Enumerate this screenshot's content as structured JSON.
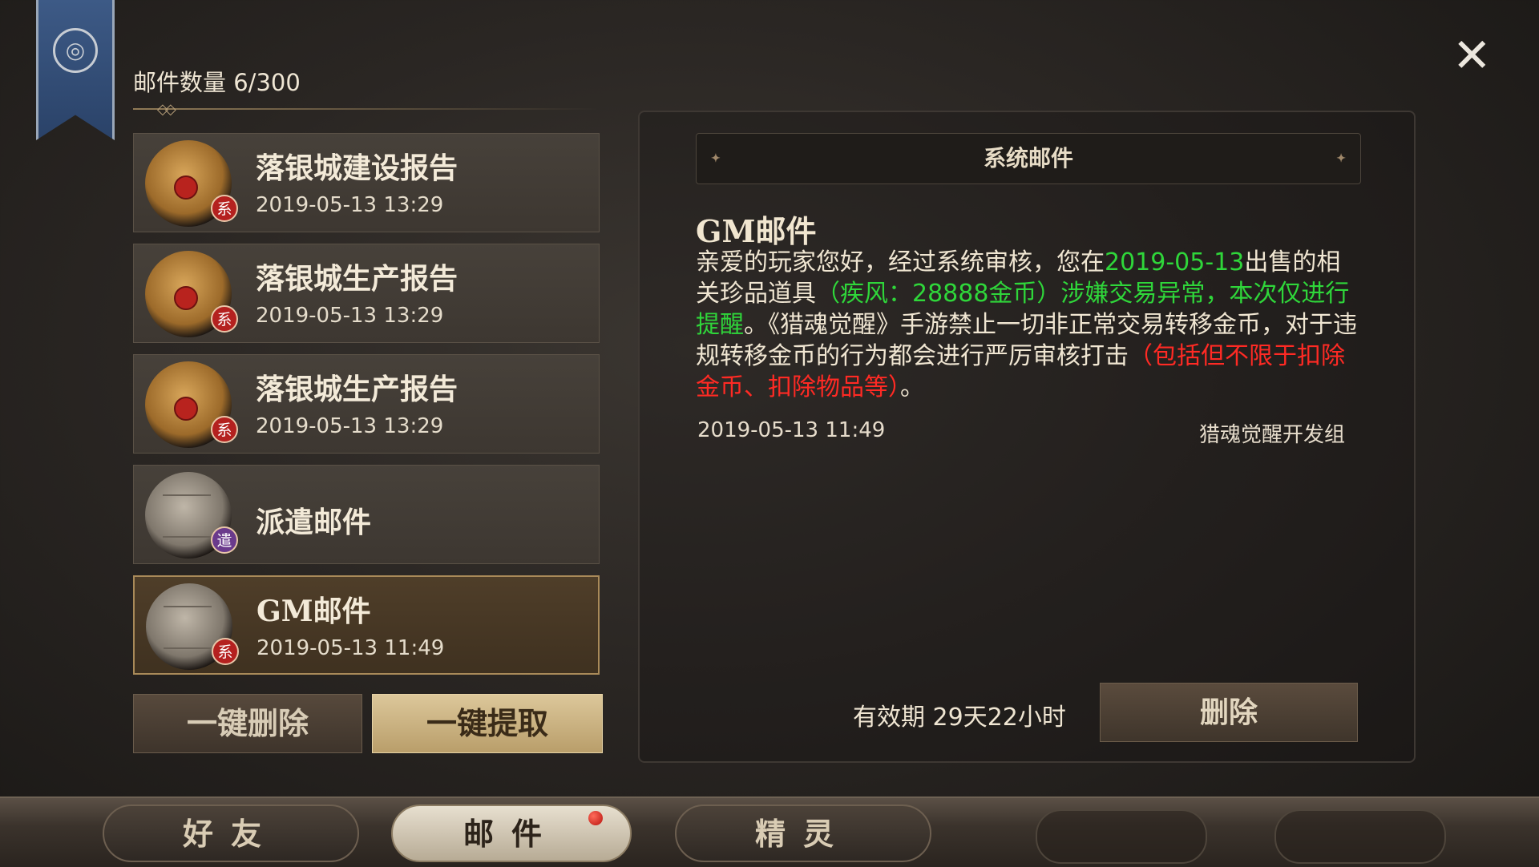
{
  "header": {
    "mail_count_label": "邮件数量 6/300"
  },
  "mail_list": [
    {
      "title": "落银城建设报告",
      "date": "2019-05-13 13:29",
      "badge": "系",
      "icon": "scroll-seal-icon"
    },
    {
      "title": "落银城生产报告",
      "date": "2019-05-13 13:29",
      "badge": "系",
      "icon": "scroll-seal-icon"
    },
    {
      "title": "落银城生产报告",
      "date": "2019-05-13 13:29",
      "badge": "系",
      "icon": "scroll-seal-icon"
    },
    {
      "title": "派遣邮件",
      "date": "",
      "badge": "遣",
      "icon": "parchment-icon"
    },
    {
      "title": "GM邮件",
      "date": "2019-05-13 11:49",
      "badge": "系",
      "icon": "parchment-icon",
      "selected": true
    }
  ],
  "list_buttons": {
    "delete_all": "一键删除",
    "collect_all": "一键提取"
  },
  "detail": {
    "header": "系统邮件",
    "title": "GM邮件",
    "body": {
      "p1": "亲爱的玩家您好，经过系统审核，您在",
      "date_green": "2019-05-13",
      "p2": "出售的相关珍品道具",
      "green_notice": "（疾风：28888金币）涉嫌交易异常，本次仅进行提醒",
      "p3": "。《猎魂觉醒》手游禁止一切非正常交易转移金币，对于违规转移金币的行为都会进行严厉审核打击",
      "red_notice": "（包括但不限于扣除金币、扣除物品等）",
      "p4": "。"
    },
    "date": "2019-05-13 11:49",
    "sender": "猎魂觉醒开发组",
    "validity": "有效期 29天22小时",
    "delete_button": "删除"
  },
  "tabs": {
    "friends": "好友",
    "mail": "邮件",
    "spirit": "精灵"
  },
  "colors": {
    "green_text": "#2fd63a",
    "red_text": "#ff2a24",
    "selected_border": "#a98a59"
  }
}
